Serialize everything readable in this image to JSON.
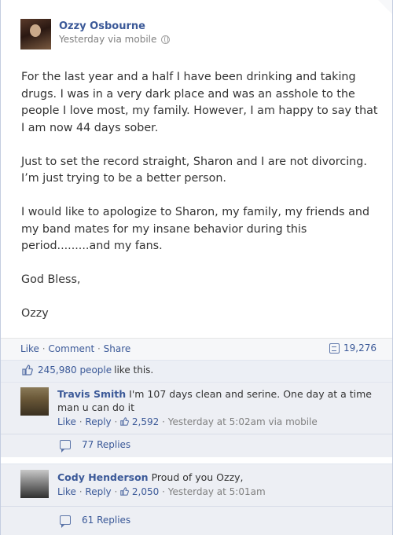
{
  "post": {
    "author": "Ozzy Osbourne",
    "timestamp": "Yesterday via mobile",
    "paragraphs": [
      "For the last year and a half I have been drinking and taking drugs. I was in a very dark place and was an asshole to the people I love most, my family. However, I am happy to say that I am now 44 days sober.",
      "Just to set the record straight, Sharon and I are not divorcing. I’m just trying to be a better person.",
      "I would like to apologize to Sharon, my family, my friends and my band mates for my insane behavior during this period.........and my fans.",
      "God Bless,",
      "Ozzy"
    ]
  },
  "actions": {
    "like": "Like",
    "comment": "Comment",
    "share": "Share",
    "share_count": "19,276"
  },
  "likes": {
    "count_text": "245,980 people",
    "suffix": "like this."
  },
  "comments": [
    {
      "name": "Travis Smith",
      "text": "I'm 107 days clean and serine. One day at a time man u can do it",
      "like": "Like",
      "reply": "Reply",
      "like_count": "2,592",
      "time": "Yesterday at 5:02am via mobile",
      "replies": "77 Replies"
    },
    {
      "name": "Cody Henderson",
      "text": "Proud of you Ozzy,",
      "like": "Like",
      "reply": "Reply",
      "like_count": "2,050",
      "time": "Yesterday at 5:01am",
      "replies": "61 Replies"
    }
  ],
  "icons": {
    "privacy": "globe-icon",
    "share": "share-icon",
    "like": "thumbs-up-icon",
    "replies": "speech-bubble-icon"
  },
  "colors": {
    "link": "#3b5998",
    "meta": "#808080",
    "comment_bg": "#edeff4"
  }
}
